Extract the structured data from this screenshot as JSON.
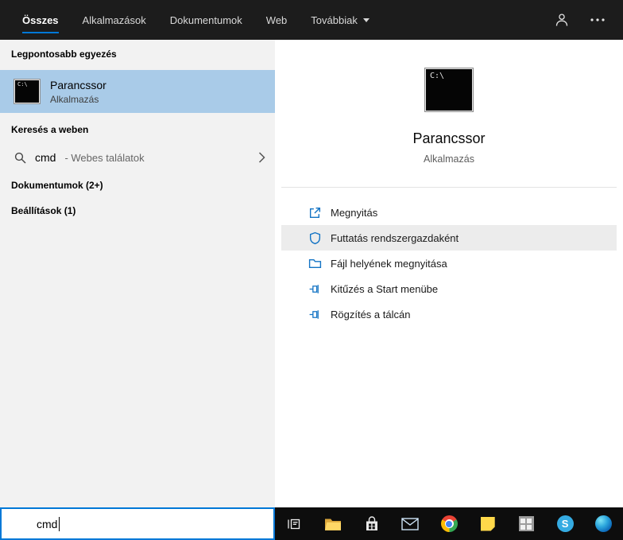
{
  "topbar": {
    "tabs": [
      {
        "label": "Összes",
        "active": true
      },
      {
        "label": "Alkalmazások",
        "active": false
      },
      {
        "label": "Dokumentumok",
        "active": false
      },
      {
        "label": "Web",
        "active": false
      },
      {
        "label": "Továbbiak",
        "active": false,
        "dropdown": true
      }
    ]
  },
  "left_panel": {
    "best_match_header": "Legpontosabb egyezés",
    "best_match": {
      "title": "Parancssor",
      "subtitle": "Alkalmazás"
    },
    "web_header": "Keresés a weben",
    "web_result": {
      "query": "cmd",
      "suffix": "- Webes találatok"
    },
    "documents_header": "Dokumentumok (2+)",
    "settings_header": "Beállítások (1)"
  },
  "preview_panel": {
    "app_title": "Parancssor",
    "app_subtitle": "Alkalmazás",
    "actions": [
      {
        "label": "Megnyitás",
        "icon": "open-icon",
        "highlighted": false
      },
      {
        "label": "Futtatás rendszergazdaként",
        "icon": "admin-shield-icon",
        "highlighted": true
      },
      {
        "label": "Fájl helyének megnyitása",
        "icon": "folder-icon",
        "highlighted": false
      },
      {
        "label": "Kitűzés a Start menübe",
        "icon": "pin-icon",
        "highlighted": false
      },
      {
        "label": "Rögzítés a tálcán",
        "icon": "pin-icon",
        "highlighted": false
      }
    ]
  },
  "search_box": {
    "value": "cmd"
  },
  "icons": {
    "cmd_prompt_glyph": "C:\\",
    "skype_glyph": "S",
    "topbar_icons": [
      "user-icon",
      "more-options-icon"
    ],
    "taskbar_icons": [
      "task-view-icon",
      "file-explorer-icon",
      "store-icon",
      "mail-icon",
      "chrome-icon",
      "sticky-notes-icon",
      "grid-app-icon",
      "skype-icon",
      "edge-icon"
    ]
  },
  "colors": {
    "accent": "#0078d7",
    "selection": "#a9cbe8",
    "topbar_bg": "#1c1c1c",
    "panel_bg": "#f2f2f2",
    "taskbar_bg": "#0d0d0d",
    "hover_row": "#ececec",
    "action_icon": "#1273c4"
  }
}
